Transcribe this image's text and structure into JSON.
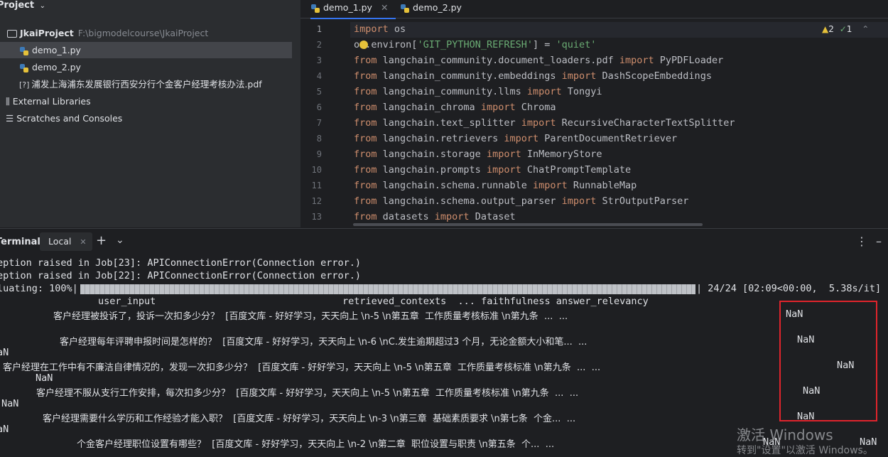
{
  "project_panel": {
    "title": "Project",
    "root_name": "JkaiProject",
    "root_path": "F:\\bigmodelcourse\\JkaiProject",
    "files": [
      "demo_1.py",
      "demo_2.py",
      "浦发上海浦东发展银行西安分行个金客户经理考核办法.pdf"
    ],
    "external_libraries": "External Libraries",
    "scratches": "Scratches and Consoles"
  },
  "editor": {
    "tabs": [
      "demo_1.py",
      "demo_2.py"
    ],
    "warnings": "2",
    "checks": "1",
    "line_numbers": [
      "1",
      "2",
      "3",
      "4",
      "5",
      "6",
      "7",
      "8",
      "9",
      "10",
      "11",
      "12",
      "13"
    ],
    "lines": [
      [
        {
          "t": "import",
          "c": "kw"
        },
        {
          "t": " os",
          "c": "tx"
        }
      ],
      [
        {
          "t": "o",
          "c": "tx"
        },
        {
          "t": "s",
          "c": "bulb"
        },
        {
          "t": ".environ[",
          "c": "tx"
        },
        {
          "t": "'GIT_PYTHON_REFRESH'",
          "c": "st"
        },
        {
          "t": "] = ",
          "c": "tx"
        },
        {
          "t": "'quiet'",
          "c": "st"
        }
      ],
      [
        {
          "t": "from",
          "c": "kw"
        },
        {
          "t": " langchain_community.document_loaders.pdf ",
          "c": "tx"
        },
        {
          "t": "import",
          "c": "kw"
        },
        {
          "t": " PyPDFLoader",
          "c": "tx"
        }
      ],
      [
        {
          "t": "from",
          "c": "kw"
        },
        {
          "t": " langchain_community.embeddings ",
          "c": "tx"
        },
        {
          "t": "import",
          "c": "kw"
        },
        {
          "t": " DashScopeEmbeddings",
          "c": "tx"
        }
      ],
      [
        {
          "t": "from",
          "c": "kw"
        },
        {
          "t": " langchain_community.llms ",
          "c": "tx"
        },
        {
          "t": "import",
          "c": "kw"
        },
        {
          "t": " Tongyi",
          "c": "tx"
        }
      ],
      [
        {
          "t": "from",
          "c": "kw"
        },
        {
          "t": " langchain_chroma ",
          "c": "tx"
        },
        {
          "t": "import",
          "c": "kw"
        },
        {
          "t": " Chroma",
          "c": "tx"
        }
      ],
      [
        {
          "t": "from",
          "c": "kw"
        },
        {
          "t": " langchain.text_splitter ",
          "c": "tx"
        },
        {
          "t": "import",
          "c": "kw"
        },
        {
          "t": " RecursiveCharacterTextSplitter",
          "c": "tx"
        }
      ],
      [
        {
          "t": "from",
          "c": "kw"
        },
        {
          "t": " langchain.retrievers ",
          "c": "tx"
        },
        {
          "t": "import",
          "c": "kw"
        },
        {
          "t": " ParentDocumentRetriever",
          "c": "tx"
        }
      ],
      [
        {
          "t": "from",
          "c": "kw"
        },
        {
          "t": " langchain.storage ",
          "c": "tx"
        },
        {
          "t": "import",
          "c": "kw"
        },
        {
          "t": " InMemoryStore",
          "c": "tx"
        }
      ],
      [
        {
          "t": "from",
          "c": "kw"
        },
        {
          "t": " langchain.prompts ",
          "c": "tx"
        },
        {
          "t": "import",
          "c": "kw"
        },
        {
          "t": " ChatPromptTemplate",
          "c": "tx"
        }
      ],
      [
        {
          "t": "from",
          "c": "kw"
        },
        {
          "t": " langchain.schema.runnable ",
          "c": "tx"
        },
        {
          "t": "import",
          "c": "kw"
        },
        {
          "t": " RunnableMap",
          "c": "tx"
        }
      ],
      [
        {
          "t": "from",
          "c": "kw"
        },
        {
          "t": " langchain.schema.output_parser ",
          "c": "tx"
        },
        {
          "t": "import",
          "c": "kw"
        },
        {
          "t": " StrOutputParser",
          "c": "tx"
        }
      ],
      [
        {
          "t": "from",
          "c": "kw"
        },
        {
          "t": " datasets ",
          "c": "tx"
        },
        {
          "t": "import",
          "c": "kw"
        },
        {
          "t": " Dataset",
          "c": "tx"
        }
      ]
    ]
  },
  "terminal": {
    "title": "Terminal",
    "tab_label": "Local",
    "lines": [
      "eption raised in Job[23]: APIConnectionError(Connection error.)",
      "eption raised in Job[22]: APIConnectionError(Connection error.)",
      "luating: 100%|",
      "| 24/24 [02:09<00:00,  5.38s/it]",
      "user_input",
      "retrieved_contexts  ... faithfulness answer_relevancy",
      "客户经理被投诉了，投诉一次扣多少分？  [百度文库 - 好好学习，天天向上 \\n-5 \\n第五章  工作质量考核标准 \\n第九条  ...  ...",
      "NaN",
      "客户经理每年评聘申报时间是怎样的？  [百度文库 - 好好学习，天天向上 \\n-6 \\nC.发生逾期超过3 个月，无论金额大小和笔...  ...",
      "NaN",
      "aN",
      "客户经理在工作中有不廉洁自律情况的，发现一次扣多少分？  [百度文库 - 好好学习，天天向上 \\n-5 \\n第五章  工作质量考核标准 \\n第九条  ...  ...",
      "NaN",
      "NaN",
      "客户经理不服从支行工作安排，每次扣多少分？  [百度文库 - 好好学习，天天向上 \\n-5 \\n第五章  工作质量考核标准 \\n第九条  ...  ...",
      "NaN",
      "NaN",
      "客户经理需要什么学历和工作经验才能入职？  [百度文库 - 好好学习，天天向上 \\n-3 \\n第三章  基础素质要求 \\n第七条  个金...  ...",
      "NaN",
      "aN",
      "个金客户经理职位设置有哪些？  [百度文库 - 好好学习，天天向上 \\n-2 \\n第二章  职位设置与职责 \\n第五条  个...  ...",
      "NaN",
      "NaN"
    ]
  },
  "watermark": {
    "line1": "激活 Windows",
    "line2": "转到\"设置\"以激活 Windows。"
  }
}
